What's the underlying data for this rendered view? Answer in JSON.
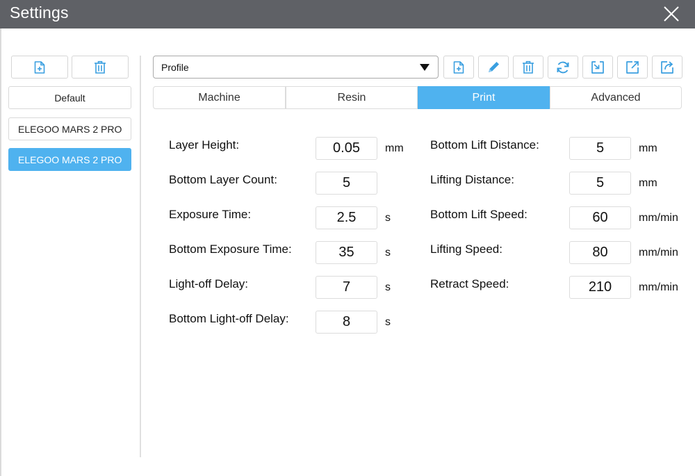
{
  "window": {
    "title": "Settings"
  },
  "sidebar": {
    "profiles": [
      {
        "label": "Default",
        "selected": false
      },
      {
        "label": "ELEGOO MARS 2 PRO",
        "selected": false
      },
      {
        "label": "ELEGOO MARS 2 PRO",
        "selected": true
      }
    ]
  },
  "toolbar": {
    "profile_select": {
      "value": "Profile"
    },
    "icons": [
      "add-file-icon",
      "pencil-icon",
      "trash-icon",
      "refresh-icon",
      "import-icon",
      "export-icon",
      "share-icon"
    ]
  },
  "tabs": [
    {
      "label": "Machine",
      "active": false
    },
    {
      "label": "Resin",
      "active": false
    },
    {
      "label": "Print",
      "active": true
    },
    {
      "label": "Advanced",
      "active": false
    }
  ],
  "print": {
    "left": [
      {
        "label": "Layer Height:",
        "value": "0.05",
        "unit": "mm"
      },
      {
        "label": "Bottom Layer Count:",
        "value": "5",
        "unit": ""
      },
      {
        "label": "Exposure Time:",
        "value": "2.5",
        "unit": "s"
      },
      {
        "label": "Bottom Exposure Time:",
        "value": "35",
        "unit": "s"
      },
      {
        "label": "Light-off Delay:",
        "value": "7",
        "unit": "s"
      },
      {
        "label": "Bottom Light-off Delay:",
        "value": "8",
        "unit": "s"
      }
    ],
    "right": [
      {
        "label": "Bottom Lift Distance:",
        "value": "5",
        "unit": "mm"
      },
      {
        "label": "Lifting Distance:",
        "value": "5",
        "unit": "mm"
      },
      {
        "label": "Bottom Lift Speed:",
        "value": "60",
        "unit": "mm/min"
      },
      {
        "label": "Lifting Speed:",
        "value": "80",
        "unit": "mm/min"
      },
      {
        "label": "Retract Speed:",
        "value": "210",
        "unit": "mm/min"
      }
    ]
  },
  "colors": {
    "titlebar": "#5f6166",
    "accent": "#4fb2ef",
    "icon_blue": "#3a9fe0"
  }
}
